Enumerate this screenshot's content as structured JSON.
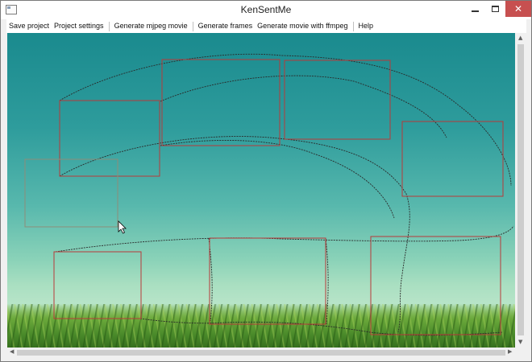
{
  "window": {
    "title": "KenSentMe",
    "close_glyph": "✕"
  },
  "menu": {
    "items": [
      {
        "key": "save_project",
        "label": "Save project"
      },
      {
        "key": "project_settings",
        "label": "Project settings"
      },
      {
        "key": "generate_mjpeg_movie",
        "label": "Generate mjpeg movie"
      },
      {
        "key": "generate_frames",
        "label": "Generate frames"
      },
      {
        "key": "generate_movie_ffmpeg",
        "label": "Generate movie with ffmpeg"
      },
      {
        "key": "help",
        "label": "Help"
      }
    ]
  },
  "scrollbars": {
    "up": "▲",
    "down": "▼",
    "left": "◀",
    "right": "▶"
  },
  "colors": {
    "keyframe_rect": "#b83a3a",
    "selected_rect": "#8d8d7a",
    "path_line": "#2a2a2a",
    "close_button": "#c75050"
  },
  "icons": {
    "cursor": "arrow-cursor-icon",
    "app": "app-window-icon"
  }
}
